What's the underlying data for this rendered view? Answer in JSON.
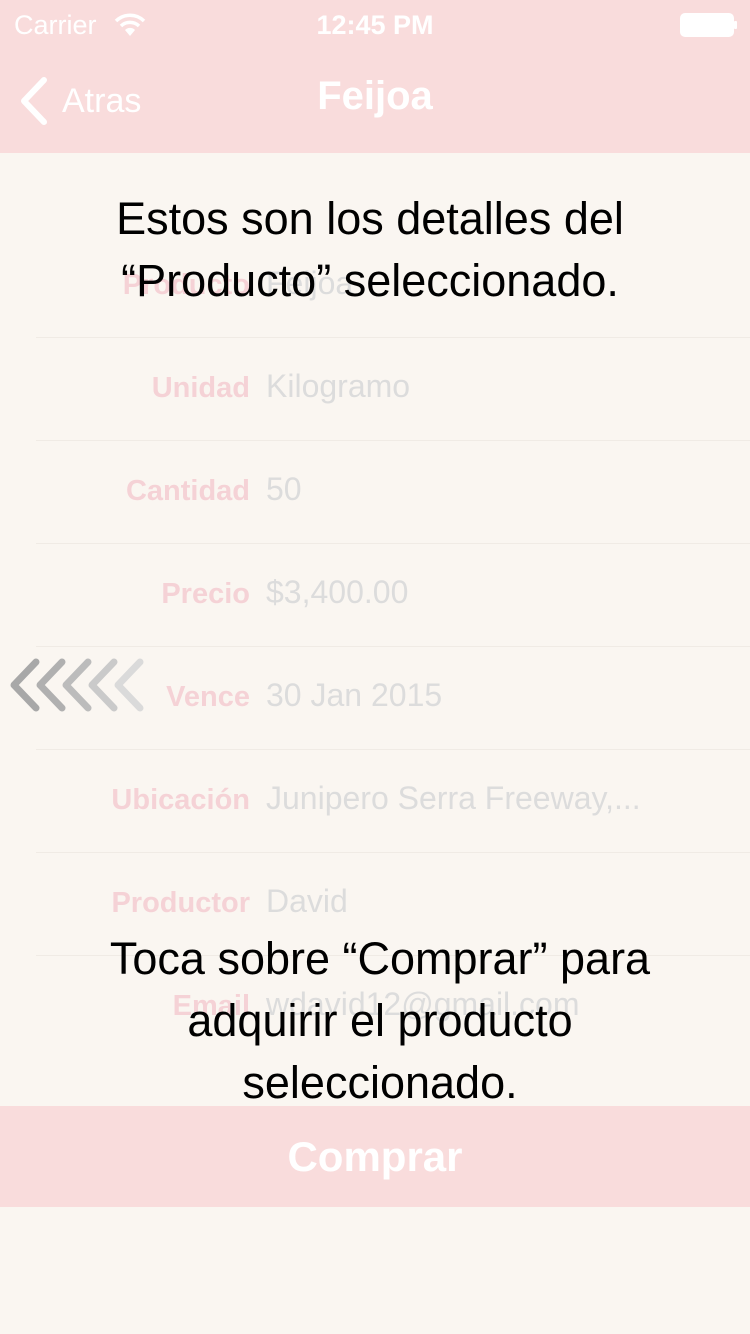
{
  "status_bar": {
    "carrier": "Carrier",
    "time": "12:45 PM"
  },
  "nav_bar": {
    "back_label": "Atras",
    "title": "Feijoa"
  },
  "details": [
    {
      "label": "Producto",
      "value": "Feijoa"
    },
    {
      "label": "Unidad",
      "value": "Kilogramo"
    },
    {
      "label": "Cantidad",
      "value": "50"
    },
    {
      "label": "Precio",
      "value": "$3,400.00"
    },
    {
      "label": "Vence",
      "value": "30 Jan 2015"
    },
    {
      "label": "Ubicación",
      "value": "Junipero Serra Freeway,..."
    },
    {
      "label": "Productor",
      "value": "David"
    },
    {
      "label": "Email",
      "value": "wdavid12@gmail.com"
    }
  ],
  "buy_button": {
    "label": "Comprar"
  },
  "tutorial": {
    "top_line1": "Estos son los detalles del",
    "top_line2": "“Producto” seleccionado.",
    "bottom_line1": "Toca sobre “Comprar” para",
    "bottom_line2": "adquirir el producto",
    "bottom_line3": "seleccionado."
  },
  "colors": {
    "bar_background": "#f9dcdc",
    "page_background": "#faf6f1",
    "label_pink": "#f5d2d6",
    "value_gray": "#dcdcdc"
  },
  "icons": {
    "back": "chevron-left-icon",
    "wifi": "wifi-icon",
    "battery": "battery-icon",
    "swipe": "swipe-left-chevrons-icon"
  }
}
